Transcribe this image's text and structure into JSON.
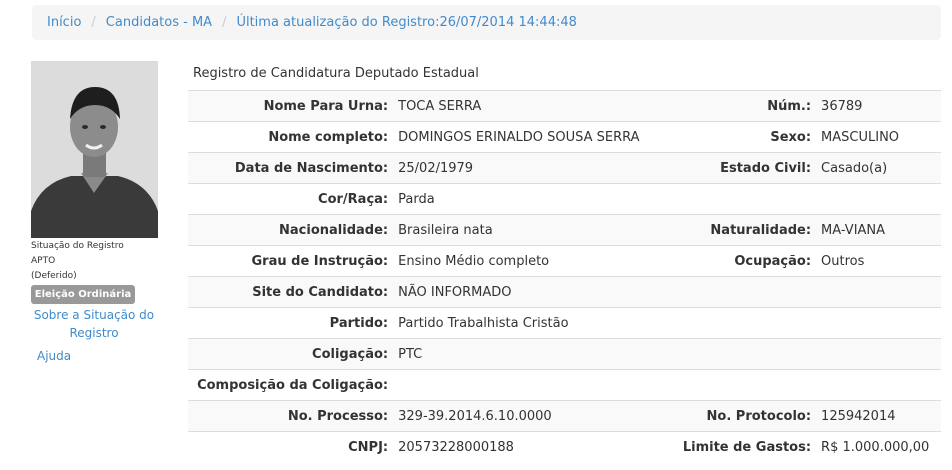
{
  "breadcrumb": {
    "home": "Início",
    "candidates": "Candidatos - MA",
    "last_update": "Última atualização do Registro:26/07/2014 14:44:48"
  },
  "sidebar": {
    "status_title": "Situação do Registro",
    "status_value": "APTO",
    "status_detail": "(Deferido)",
    "election_badge": "Eleição Ordinária",
    "about_link": "Sobre a Situação do Registro",
    "help_link": "Ajuda"
  },
  "main": {
    "caption": "Registro de Candidatura Deputado Estadual",
    "rows": [
      {
        "label1": "Nome Para Urna:",
        "value1": "TOCA SERRA",
        "label2": "Núm.:",
        "value2": "36789"
      },
      {
        "label1": "Nome completo:",
        "value1": "DOMINGOS ERINALDO SOUSA SERRA",
        "label2": "Sexo:",
        "value2": "MASCULINO"
      },
      {
        "label1": "Data de Nascimento:",
        "value1": "25/02/1979",
        "label2": "Estado Civil:",
        "value2": "Casado(a)"
      },
      {
        "label1": "Cor/Raça:",
        "value1": "Parda",
        "label2": "",
        "value2": ""
      },
      {
        "label1": "Nacionalidade:",
        "value1": "Brasileira nata",
        "label2": "Naturalidade:",
        "value2": "MA-VIANA"
      },
      {
        "label1": "Grau de Instrução:",
        "value1": "Ensino Médio completo",
        "label2": "Ocupação:",
        "value2": "Outros"
      },
      {
        "label1": "Site do Candidato:",
        "value1": "NÃO INFORMADO",
        "label2": "",
        "value2": ""
      },
      {
        "label1": "Partido:",
        "value1": "Partido Trabalhista Cristão",
        "label2": "",
        "value2": ""
      },
      {
        "label1": "Coligação:",
        "value1": "PTC",
        "label2": "",
        "value2": ""
      },
      {
        "label1": "Composição da Coligação:",
        "value1": "",
        "label2": "",
        "value2": ""
      },
      {
        "label1": "No. Processo:",
        "value1": "329-39.2014.6.10.0000",
        "label2": "No. Protocolo:",
        "value2": "125942014"
      },
      {
        "label1": "CNPJ:",
        "value1": "20573228000188",
        "label2": "Limite de Gastos:",
        "value2": "R$ 1.000.000,00"
      }
    ]
  }
}
